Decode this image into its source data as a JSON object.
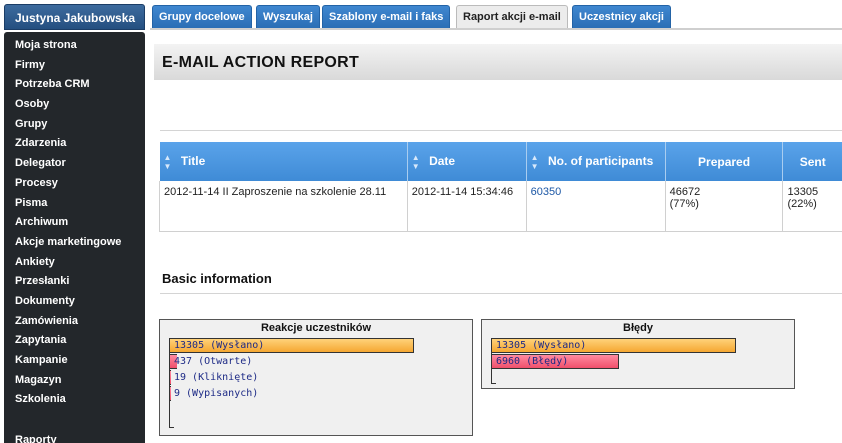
{
  "user": {
    "name": "Justyna Jakubowska"
  },
  "menu": [
    "Moja strona",
    "Firmy",
    "Potrzeba CRM",
    "Osoby",
    "Grupy",
    "Zdarzenia",
    "Delegator",
    "Procesy",
    "Pisma",
    "Archiwum",
    "Akcje marketingowe",
    "Ankiety",
    "Przesłanki",
    "Dokumenty",
    "Zamówienia",
    "Zapytania",
    "Kampanie",
    "Magazyn",
    "Szkolenia"
  ],
  "menu_bottom": "Raporty",
  "tabs": [
    {
      "label": "Grupy docelowe",
      "active": false
    },
    {
      "label": "Wyszukaj",
      "active": false
    },
    {
      "label": "Szablony e-mail i faks",
      "active": false
    },
    {
      "label": "Raport akcji e-mail",
      "active": true
    },
    {
      "label": "Uczestnicy akcji",
      "active": false
    }
  ],
  "page": {
    "title": "E-MAIL ACTION REPORT"
  },
  "table": {
    "headers": {
      "title": "Title",
      "date": "Date",
      "participants": "No. of participants",
      "prepared": "Prepared",
      "sent": "Sent"
    },
    "row": {
      "title": "2012-11-14 II Zaproszenie na szkolenie 28.11",
      "date": "2012-11-14 15:34:46",
      "participants": "60350",
      "prepared_count": "46672",
      "prepared_pct": "(77%)",
      "sent_count": "13305",
      "sent_pct": "(22%)"
    }
  },
  "section": {
    "basic_info": "Basic information"
  },
  "charts": {
    "reactions": {
      "title": "Reakcje uczestników",
      "bars": [
        {
          "label": "13305 (Wysłano)",
          "value": 13305
        },
        {
          "label": "437 (Otwarte)",
          "value": 437
        },
        {
          "label": "19 (Kliknięte)",
          "value": 19
        },
        {
          "label": "9 (Wypisanych)",
          "value": 9
        }
      ]
    },
    "errors": {
      "title": "Błędy",
      "bars": [
        {
          "label": "13305 (Wysłano)",
          "value": 13305
        },
        {
          "label": "6960 (Błędy)",
          "value": 6960
        }
      ]
    }
  },
  "colors": {
    "sidebar_bg": "#23272b",
    "tab_blue": "#3f87d0",
    "header_blue": "#4b95df",
    "bar_orange": "#f5a732",
    "bar_red": "#f0506c"
  }
}
